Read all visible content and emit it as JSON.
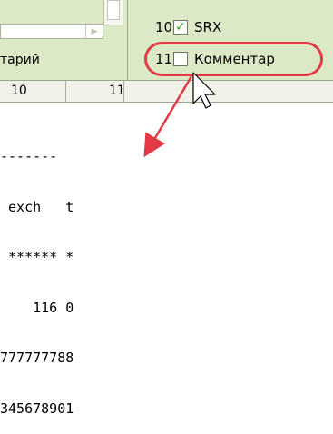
{
  "top_panel": {
    "left_column_label": "тарий"
  },
  "checklist": {
    "items": [
      {
        "number": "10",
        "label": "SRX",
        "checked": true
      },
      {
        "number": "11",
        "label": "Комментар",
        "checked": false
      }
    ]
  },
  "grid_header": {
    "columns": [
      "10",
      "11"
    ]
  },
  "text_output": {
    "lines": [
      "-------",
      " exch   t",
      " ****** *",
      "    116 0",
      "777777788",
      "345678901"
    ]
  },
  "annotation": {
    "color": "#e43a45"
  }
}
